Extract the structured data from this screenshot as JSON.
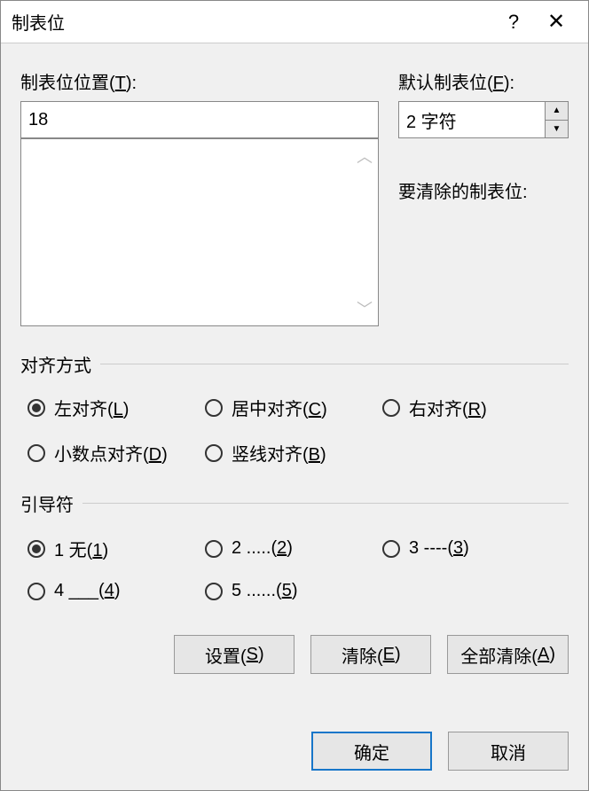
{
  "titlebar": {
    "title": "制表位",
    "help": "?",
    "close": "✕"
  },
  "labels": {
    "tab_position": "制表位位置(T):",
    "default_tab": "默认制表位(F):",
    "to_clear": "要清除的制表位:"
  },
  "inputs": {
    "tab_position_value": "18",
    "default_tab_value": "2 字符"
  },
  "alignment": {
    "title": "对齐方式",
    "options": {
      "left": "左对齐(L)",
      "center": "居中对齐(C)",
      "right": "右对齐(R)",
      "decimal": "小数点对齐(D)",
      "bar": "竖线对齐(B)"
    }
  },
  "leader": {
    "title": "引导符",
    "options": {
      "none": "1 无(1)",
      "dots1": "2 .....(2)",
      "dashes": "3 ----(3)",
      "underscore": "4 ___(4)",
      "dots2": "5 ......(5)"
    }
  },
  "buttons": {
    "set": "设置(S)",
    "clear": "清除(E)",
    "clear_all": "全部清除(A)",
    "ok": "确定",
    "cancel": "取消"
  }
}
